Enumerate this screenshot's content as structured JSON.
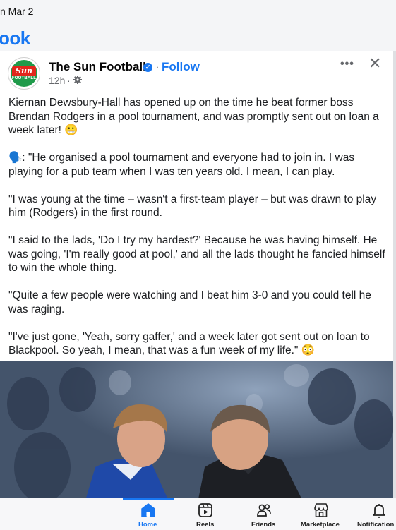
{
  "status_bar": {
    "date": "n Mar 2"
  },
  "app": {
    "logo_text": "ook"
  },
  "post": {
    "page_name": "The Sun Football",
    "follow_label": "Follow",
    "separator": "·",
    "time": "12h",
    "time_separator": "·",
    "more_label": "•••",
    "close_label": "✕",
    "verified_icon": "verified-badge-icon",
    "avatar": {
      "brand_text": "Sun",
      "sub_text": "FOOTBALL"
    },
    "paragraphs": [
      "Kiernan Dewsbury-Hall has opened up on the time he beat former boss Brendan Rodgers in a pool tournament, and was promptly sent out on loan a week later! 😬",
      "🗣️: \"He organised a pool tournament and everyone had to join in. I was playing for a pub team when I was ten years old. I mean, I can play.",
      "\"I was young at the time – wasn't a first-team player – but was drawn to play him (Rodgers) in the first round.",
      "\"I said to the lads, 'Do I try my hardest?' Because he was having himself. He was going, 'I'm really good at pool,' and all the lads thought he fancied himself to win the whole thing.",
      "\"Quite a few people were watching and I beat him 3-0 and you could tell he was raging.",
      "\"I've just gone, 'Yeah, sorry gaffer,' and a week later got sent out on loan to Blackpool. So yeah, I mean, that was a fun week of my life.\" 😳"
    ]
  },
  "bottom_nav": {
    "active": "Home",
    "accent_color": "#1877f2",
    "items": [
      {
        "label": "Home",
        "icon": "home-icon"
      },
      {
        "label": "Reels",
        "icon": "reels-icon"
      },
      {
        "label": "Friends",
        "icon": "friends-icon"
      },
      {
        "label": "Marketplace",
        "icon": "marketplace-icon"
      },
      {
        "label": "Notification",
        "icon": "bell-icon"
      }
    ]
  },
  "colors": {
    "brand_blue": "#1877f2",
    "sun_red": "#e1261c",
    "sun_green": "#1f9a4a"
  }
}
